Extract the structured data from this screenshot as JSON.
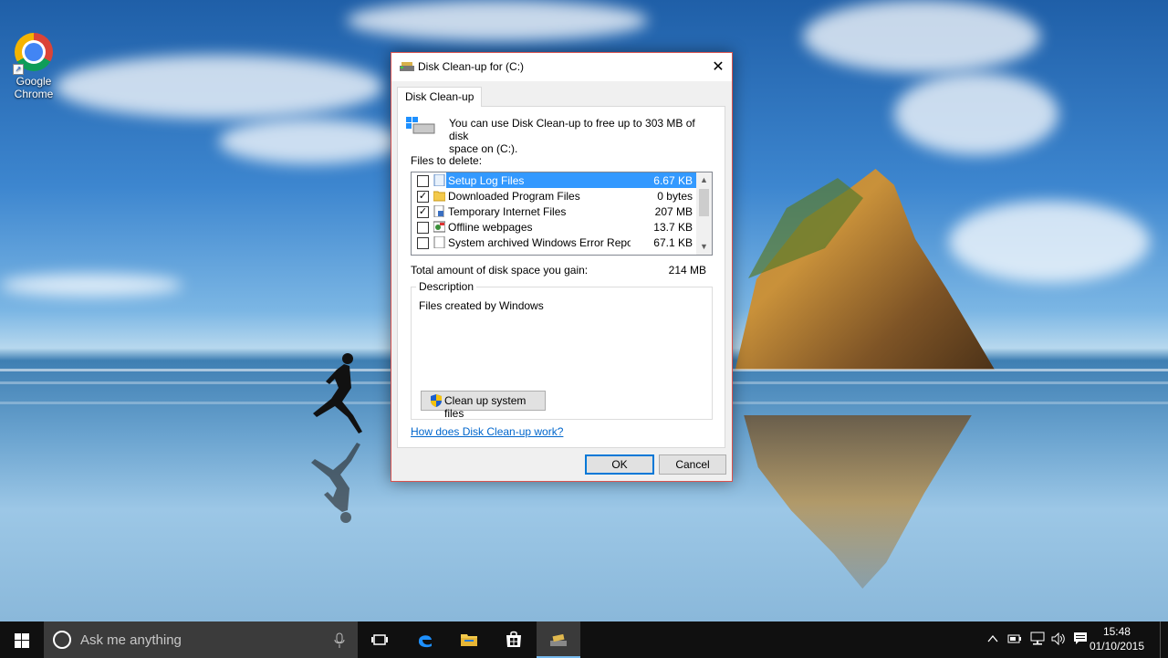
{
  "desktop": {
    "icons": [
      {
        "label_line1": "Google",
        "label_line2": "Chrome",
        "icon": "chrome-icon"
      }
    ]
  },
  "dialog": {
    "title": "Disk Clean-up for  (C:)",
    "tab_label": "Disk Clean-up",
    "intro_line1": "You can use Disk Clean-up to free up to 303 MB of disk",
    "intro_line2": "space on  (C:).",
    "files_to_delete_label": "Files to delete:",
    "files": [
      {
        "name": "Setup Log Files",
        "size": "6.67 KB",
        "checked": false,
        "selected": true,
        "icon": "file-icon"
      },
      {
        "name": "Downloaded Program Files",
        "size": "0 bytes",
        "checked": true,
        "selected": false,
        "icon": "folder-icon"
      },
      {
        "name": "Temporary Internet Files",
        "size": "207 MB",
        "checked": true,
        "selected": false,
        "icon": "file-lock-icon"
      },
      {
        "name": "Offline webpages",
        "size": "13.7 KB",
        "checked": false,
        "selected": false,
        "icon": "offline-page-icon"
      },
      {
        "name": "System archived Windows Error Repor...",
        "size": "67.1 KB",
        "checked": false,
        "selected": false,
        "icon": "file-icon"
      }
    ],
    "total_label": "Total amount of disk space you gain:",
    "total_value": "214 MB",
    "description_legend": "Description",
    "description_text": "Files created by Windows",
    "cleanup_system_button": "Clean up system files",
    "help_link": "How does Disk Clean-up work?",
    "ok_button": "OK",
    "cancel_button": "Cancel"
  },
  "taskbar": {
    "search_placeholder": "Ask me anything",
    "time": "15:48",
    "date": "01/10/2015",
    "pinned": [
      "task-view-icon",
      "edge-icon",
      "file-explorer-icon",
      "store-icon",
      "disk-cleanup-icon"
    ],
    "active_app": "disk-cleanup-icon",
    "accent_color": "#76b9ed"
  }
}
